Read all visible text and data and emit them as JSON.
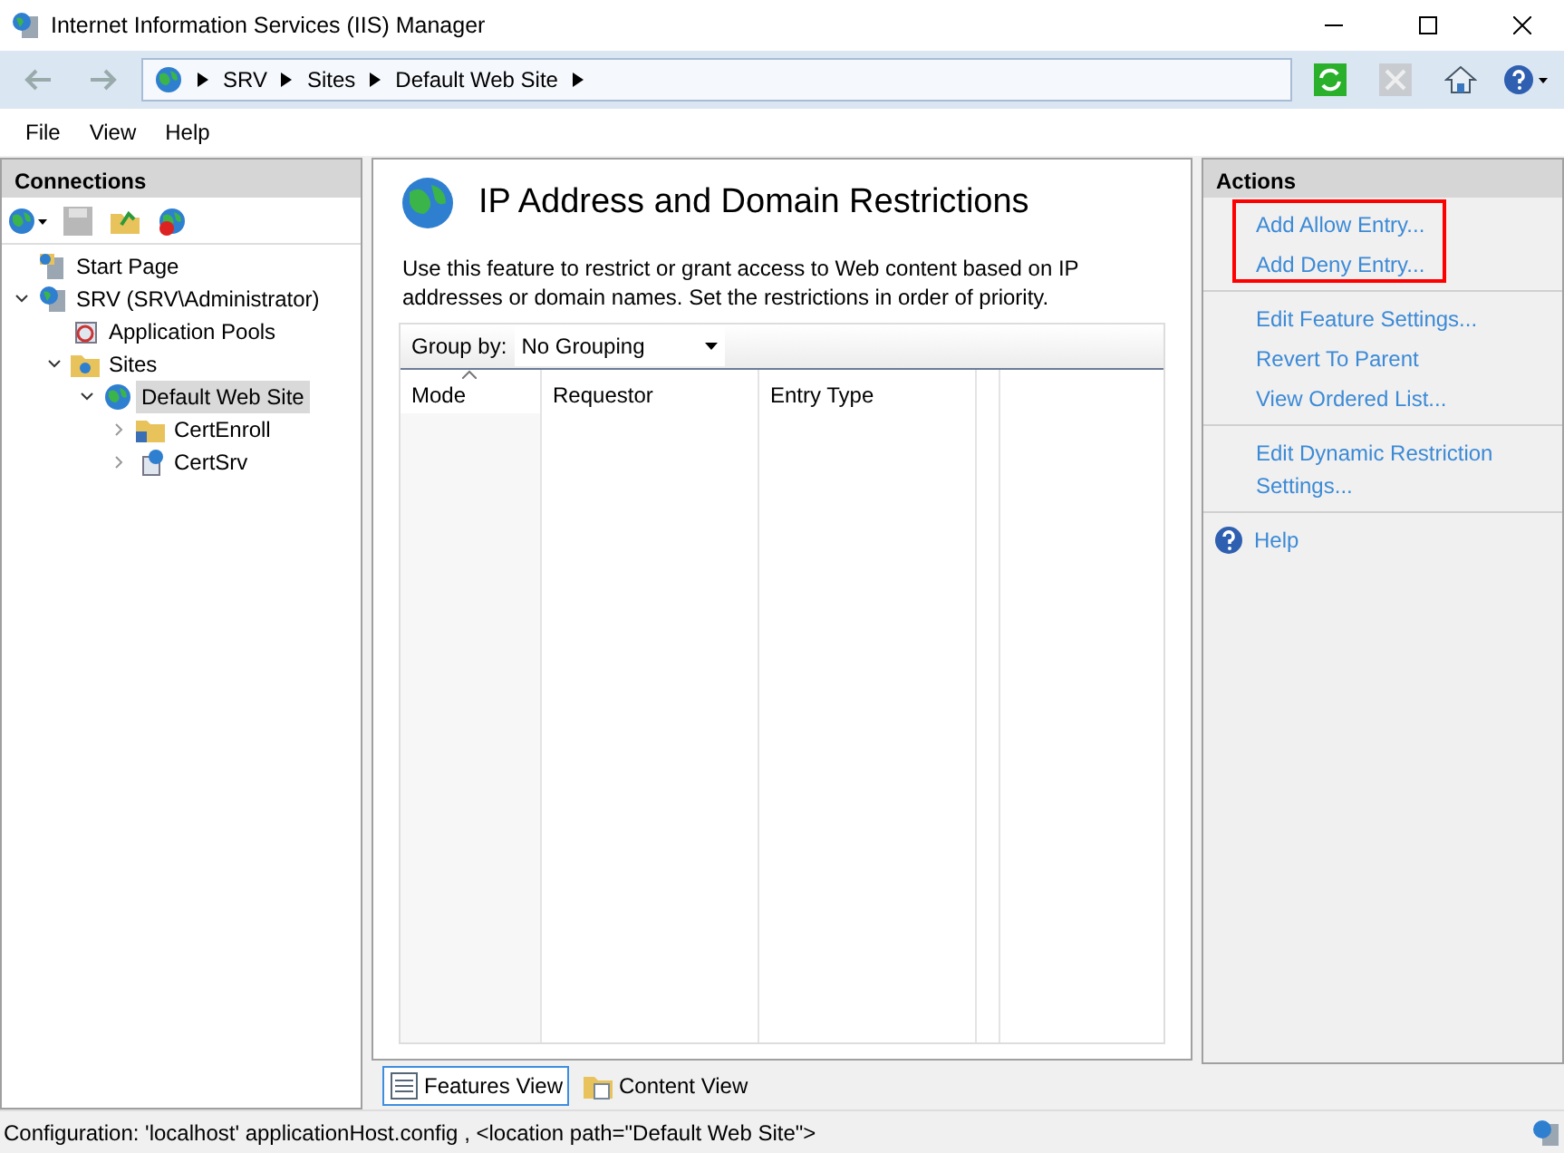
{
  "window": {
    "title": "Internet Information Services (IIS) Manager"
  },
  "address_bar": {
    "crumbs": [
      "SRV",
      "Sites",
      "Default Web Site"
    ]
  },
  "menu": [
    "File",
    "View",
    "Help"
  ],
  "connections": {
    "title": "Connections",
    "tree": [
      {
        "label": "Start Page",
        "kind": "start",
        "selected": false
      },
      {
        "label": "SRV (SRV\\Administrator)",
        "kind": "server",
        "expanded": true,
        "selected": false,
        "children": [
          {
            "label": "Application Pools",
            "kind": "pools",
            "selected": false
          },
          {
            "label": "Sites",
            "kind": "sites",
            "expanded": true,
            "selected": false,
            "children": [
              {
                "label": "Default Web Site",
                "kind": "site",
                "expanded": true,
                "selected": true,
                "children": [
                  {
                    "label": "CertEnroll",
                    "kind": "folder",
                    "expanded": false,
                    "selected": false
                  },
                  {
                    "label": "CertSrv",
                    "kind": "app",
                    "expanded": false,
                    "selected": false
                  }
                ]
              }
            ]
          }
        ]
      }
    ]
  },
  "feature": {
    "title": "IP Address and Domain Restrictions",
    "description": "Use this feature to restrict or grant access to Web content based on IP addresses or domain names. Set the restrictions in order of priority.",
    "group_by": {
      "label": "Group by:",
      "value": "No Grouping"
    },
    "table": {
      "columns": [
        {
          "label": "Mode",
          "sorted": true
        },
        {
          "label": "Requestor",
          "sorted": false
        },
        {
          "label": "Entry Type",
          "sorted": false
        }
      ]
    }
  },
  "view_tabs": [
    {
      "label": "Features View",
      "selected": true
    },
    {
      "label": "Content View",
      "selected": false
    }
  ],
  "actions": {
    "title": "Actions",
    "groups": [
      {
        "highlighted": true,
        "items": [
          {
            "label": "Add Allow Entry..."
          },
          {
            "label": "Add Deny Entry..."
          }
        ]
      },
      {
        "highlighted": false,
        "items": [
          {
            "label": "Edit Feature Settings..."
          },
          {
            "label": "Revert To Parent"
          },
          {
            "label": "View Ordered List..."
          }
        ]
      },
      {
        "highlighted": false,
        "items": [
          {
            "label": "Edit Dynamic Restriction Settings..."
          }
        ]
      },
      {
        "highlighted": false,
        "items": [
          {
            "label": "Help",
            "kind": "help"
          }
        ]
      }
    ]
  },
  "status_bar": {
    "text": "Configuration: 'localhost' applicationHost.config , <location path=\"Default Web Site\">"
  }
}
